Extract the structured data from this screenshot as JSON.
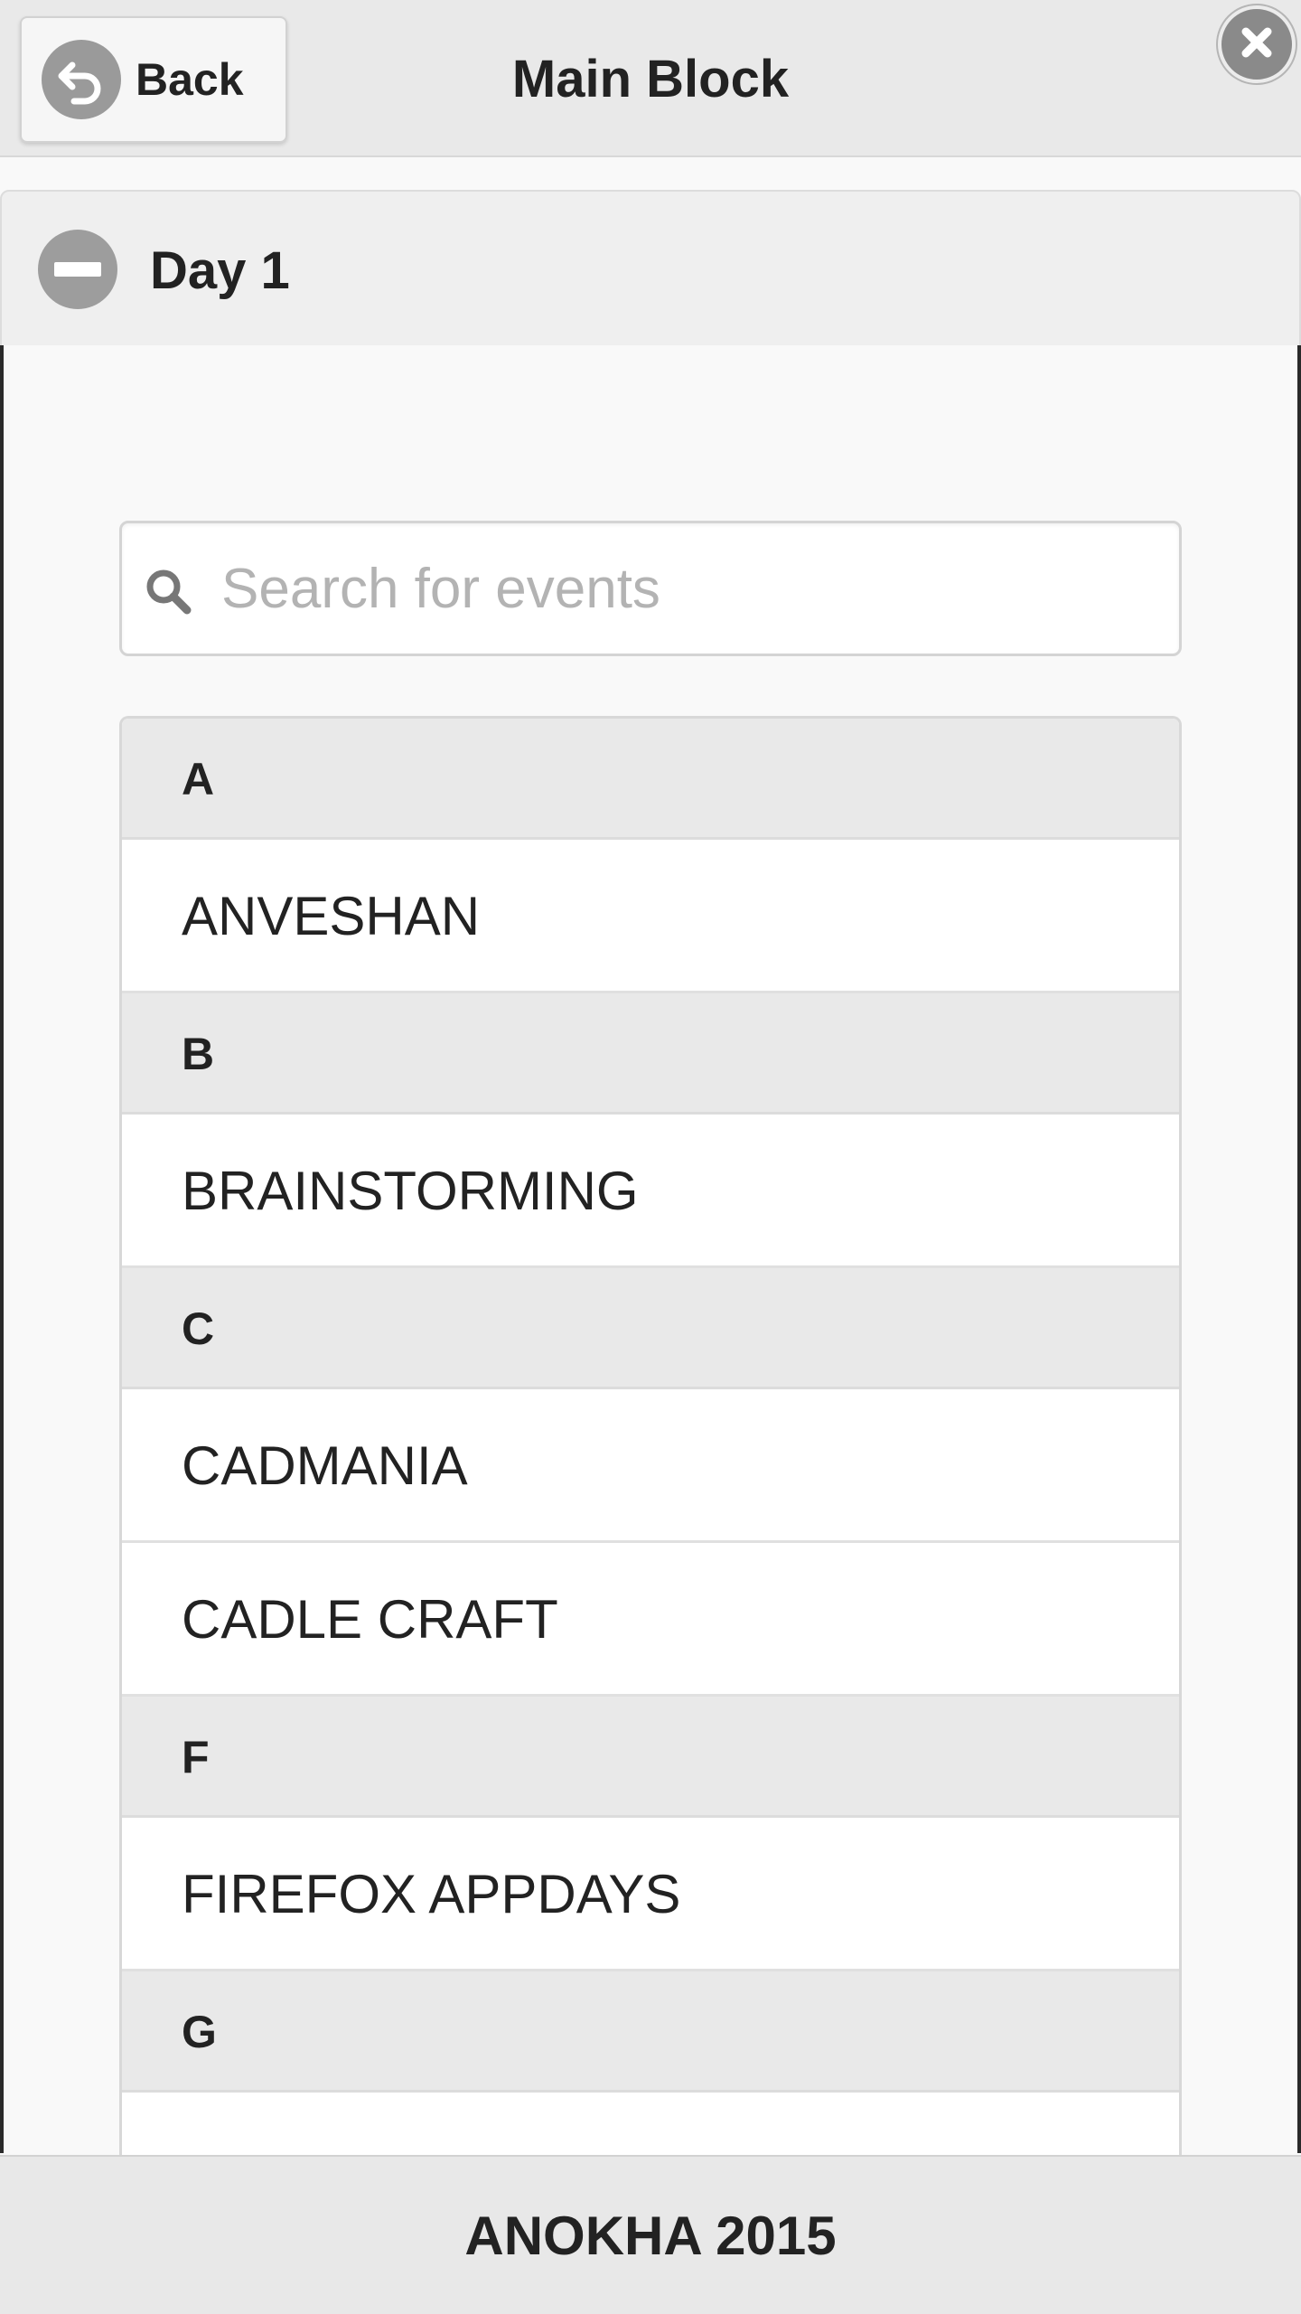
{
  "header": {
    "back_label": "Back",
    "title": "Main Block",
    "back_icon": "back-arrow-icon",
    "close_icon": "close-icon"
  },
  "section": {
    "title": "Day 1",
    "toggle_icon": "minus-icon"
  },
  "search": {
    "placeholder": "Search for events",
    "value": ""
  },
  "list": {
    "groups": [
      {
        "letter": "A",
        "items": [
          "ANVESHAN"
        ]
      },
      {
        "letter": "B",
        "items": [
          "BRAINSTORMING"
        ]
      },
      {
        "letter": "C",
        "items": [
          "CADMANIA",
          "CADLE CRAFT"
        ]
      },
      {
        "letter": "F",
        "items": [
          "FIREFOX APPDAYS"
        ]
      },
      {
        "letter": "G",
        "items": [
          ""
        ]
      }
    ]
  },
  "footer": {
    "text": "ANOKHA 2015"
  }
}
